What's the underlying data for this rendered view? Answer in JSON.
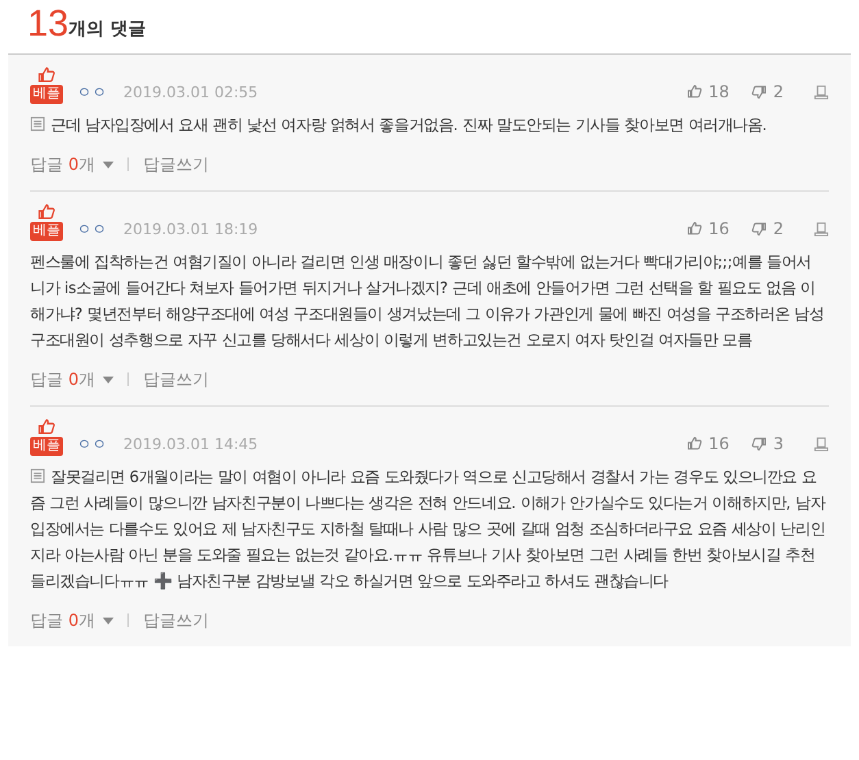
{
  "header": {
    "count": "13",
    "label": "개의 댓글"
  },
  "comments": [
    {
      "badge": "베플",
      "author": "ㅇㅇ",
      "date": "2019.03.01 02:55",
      "likes": "18",
      "dislikes": "2",
      "note": true,
      "text": "근데 남자입장에서 요새 괜히 낯선 여자랑 얽혀서 좋을거없음. 진짜 말도안되는 기사들 찾아보면 여러개나옴.",
      "reply_label": "답글",
      "reply_count": "0",
      "reply_unit": "개",
      "write": "답글쓰기"
    },
    {
      "badge": "베플",
      "author": "ㅇㅇ",
      "date": "2019.03.01 18:19",
      "likes": "16",
      "dislikes": "2",
      "note": false,
      "text": "펜스룰에 집착하는건 여혐기질이 아니라 걸리면 인생 매장이니 좋던 싫던 할수밖에 없는거다 빡대가리야;;;예를 들어서 니가 is소굴에 들어간다 쳐보자 들어가면 뒤지거나 살거나겠지? 근데 애초에 안들어가면 그런 선택을 할 필요도 없음 이해가냐? 몇년전부터 해양구조대에 여성 구조대원들이 생겨났는데 그 이유가 가관인게 물에 빠진 여성을 구조하러온 남성 구조대원이 성추행으로 자꾸 신고를 당해서다 세상이 이렇게 변하고있는건 오로지 여자 탓인걸 여자들만 모름",
      "reply_label": "답글",
      "reply_count": "0",
      "reply_unit": "개",
      "write": "답글쓰기"
    },
    {
      "badge": "베플",
      "author": "ㅇㅇ",
      "date": "2019.03.01 14:45",
      "likes": "16",
      "dislikes": "3",
      "note": true,
      "text": "잘못걸리면 6개월이라는 말이 여혐이 아니라 요즘 도와줬다가 역으로 신고당해서 경찰서 가는 경우도 있으니깐요 요즘 그런 사례들이 많으니깐 남자친구분이 나쁘다는 생각은 전혀 안드네요. 이해가 안가실수도 있다는거 이해하지만, 남자입장에서는 다를수도 있어요 제 남자친구도 지하철 탈때나 사람 많으 곳에 갈때 엄청 조심하더라구요 요즘 세상이 난리인지라 아는사람 아닌 분을 도와줄 필요는 없는것 같아요.ㅠㅠ 유튜브나 기사 찾아보면 그런 사례들 한번 찾아보시길 추천 들리겠습니다ㅠㅠ ➕ 남자친구분 감방보낼 각오 하실거면 앞으로 도와주라고 하셔도 괜찮습니다",
      "reply_label": "답글",
      "reply_count": "0",
      "reply_unit": "개",
      "write": "답글쓰기"
    }
  ]
}
